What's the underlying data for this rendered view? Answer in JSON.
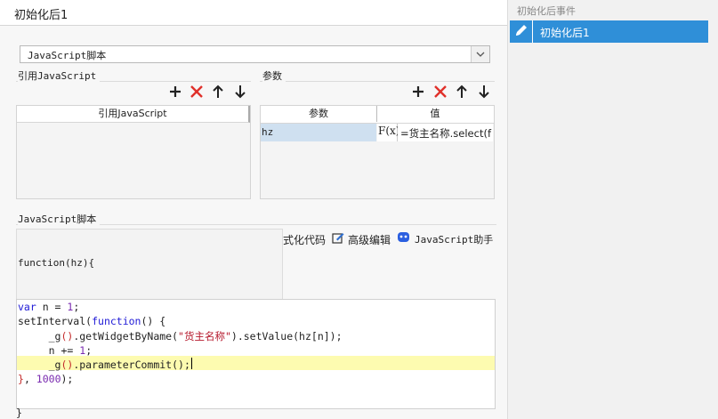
{
  "dialog": {
    "title": "初始化后1",
    "script_type_select": "JavaScript脚本",
    "ref_section_title": "引用JavaScript",
    "ref_column": "引用JavaScript",
    "params_section_title": "参数",
    "params_columns": [
      "参数",
      "值"
    ],
    "params_rows": [
      {
        "name": "hz",
        "formula_icon": "F(x)",
        "value": "=货主名称.select(f"
      }
    ],
    "script_section_title": "JavaScript脚本",
    "function_header": "function(hz){",
    "format_code": "式化代码",
    "advanced_edit": "高级编辑",
    "js_assistant": "JavaScript助手",
    "code_lines": [
      [
        [
          "kw",
          "var"
        ],
        [
          "fn",
          " n = "
        ],
        [
          "num",
          "1"
        ],
        [
          "fn",
          ";"
        ]
      ],
      [
        [
          "fn",
          "setInterval("
        ],
        [
          "kw",
          "function"
        ],
        [
          "fn",
          "() {"
        ]
      ],
      [
        [
          "fn",
          "     _g"
        ],
        [
          "paren",
          "()"
        ],
        [
          "fn",
          ".getWidgetByName("
        ],
        [
          "str",
          "\"货主名称\""
        ],
        [
          "fn",
          ").setValue(hz[n]);"
        ]
      ],
      [
        [
          "fn",
          "     n += "
        ],
        [
          "num",
          "1"
        ],
        [
          "fn",
          ";"
        ]
      ],
      [
        [
          "fn",
          "     _g"
        ],
        [
          "paren",
          "()"
        ],
        [
          "fn",
          ".parameterCommit();"
        ]
      ],
      [
        [
          "paren",
          "}"
        ],
        [
          "fn",
          ", "
        ],
        [
          "num",
          "1000"
        ],
        [
          "fn",
          ");"
        ]
      ]
    ],
    "closing_brace": "}"
  },
  "events_panel": {
    "header": "初始化后事件",
    "items": [
      {
        "label": "初始化后1",
        "selected": true
      }
    ]
  },
  "colors": {
    "selected_item": "#2f8fd8",
    "highlight_line": "#fdfbb0",
    "delete_red": "#e0302a",
    "param_cell": "#cfe0f0"
  }
}
